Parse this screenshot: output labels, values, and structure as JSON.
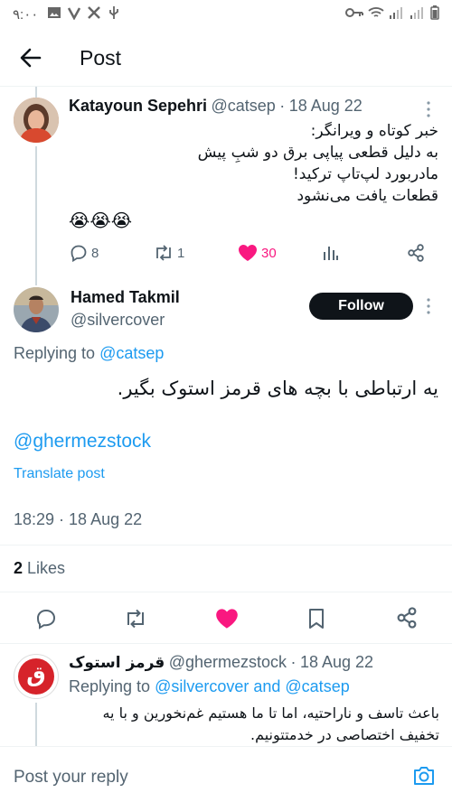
{
  "statusbar": {
    "time": "۹:۰۰",
    "icons_left": [
      "image-icon",
      "check-v-icon",
      "twitter-x-icon",
      "usb-icon"
    ],
    "icons_right": [
      "key-icon",
      "wifi-icon",
      "signal-icon",
      "signal-icon",
      "battery-icon"
    ]
  },
  "header": {
    "title": "Post",
    "back_icon": "arrow-left-icon"
  },
  "parent_tweet": {
    "name": "Katayoun Sepehri",
    "handle": "@catsep",
    "date": "18 Aug 22",
    "lines": [
      "خبر کوتاه و ویرانگر:",
      "به دلیل قطعی پیاپی برق دو شبِ پیش",
      "مادربورد لپ‌تاپ ترکید!",
      "قطعات یافت می‌نشود"
    ],
    "emoji": "😭😭😭",
    "reply_count": "8",
    "retweet_count": "1",
    "like_count": "30"
  },
  "main_tweet": {
    "name": "Hamed Takmil",
    "handle": "@silvercover",
    "follow_label": "Follow",
    "replying_prefix": "Replying to",
    "replying_handle": "@catsep",
    "text": "یه ارتباطی با بچه های قرمز استوک بگیر.",
    "mention": "@ghermezstock",
    "translate": "Translate post",
    "timestamp": "18:29 · 18 Aug 22",
    "likes_count": "2",
    "likes_label": "Likes"
  },
  "reply_tweet": {
    "name": "قرمز استوک",
    "handle": "@ghermezstock",
    "date": "18 Aug 22",
    "avatar_letter": "ق",
    "replying_prefix": "Replying to",
    "replying_handles": "@silvercover and @catsep",
    "lines": [
      "باعث تاسف و ناراحتیه، اما تا ما هستیم غم‌نخورین و با یه",
      "تخفیف اختصاصی در خدمتتونیم."
    ]
  },
  "composer": {
    "placeholder": "Post your reply"
  },
  "colors": {
    "accent": "#1d9bf0",
    "like": "#f91880",
    "text": "#0f1419",
    "muted": "#536471"
  }
}
